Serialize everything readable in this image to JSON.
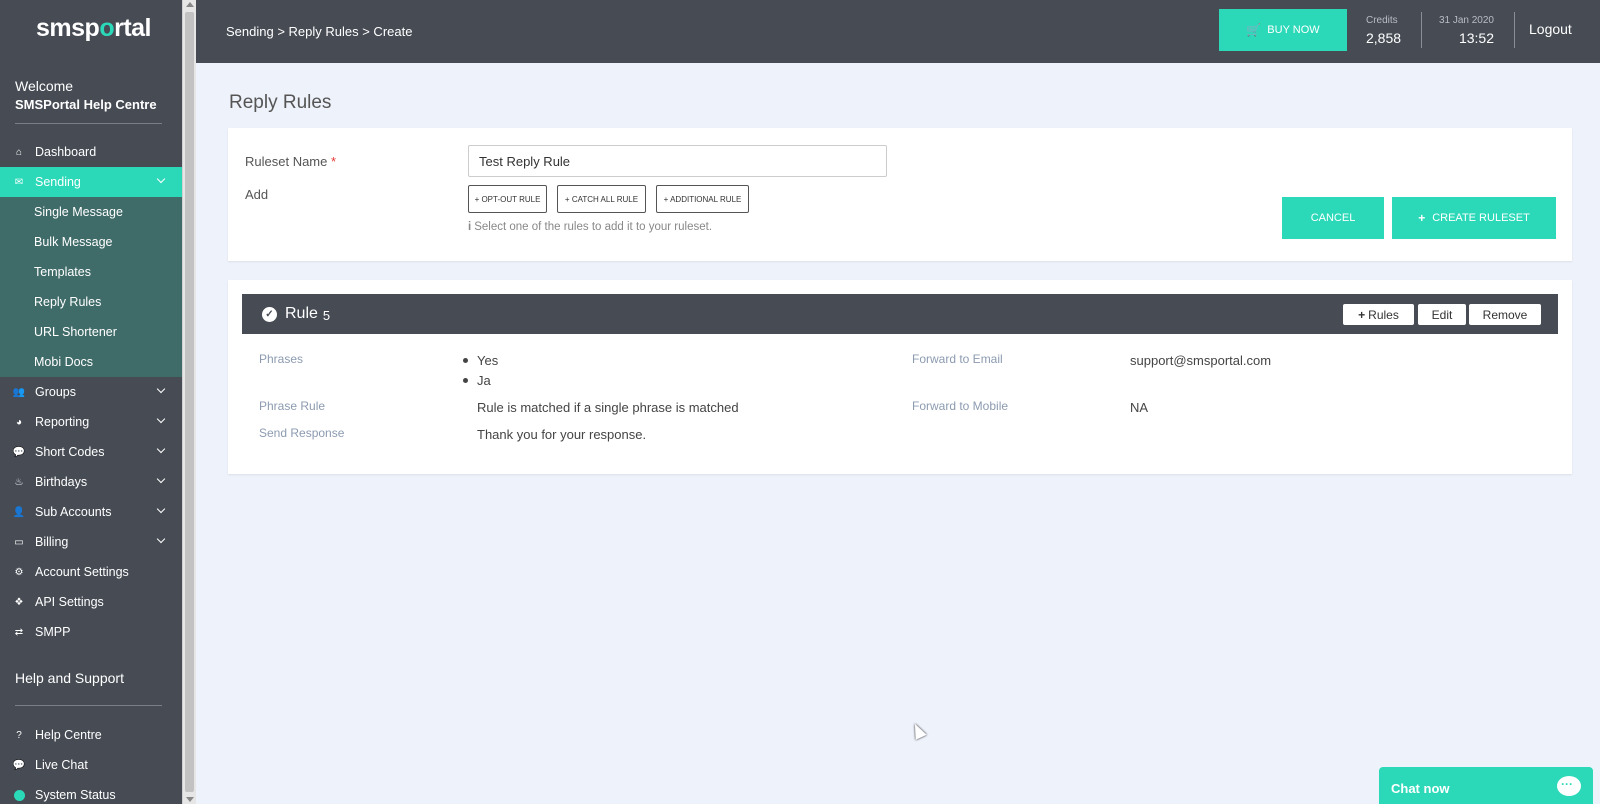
{
  "sidebar": {
    "logo_prefix": "smsp",
    "logo_o": "o",
    "logo_suffix": "rtal",
    "welcome": "Welcome",
    "account_name": "SMSPortal Help Centre",
    "nav": {
      "dashboard": "Dashboard",
      "sending": "Sending",
      "sub": {
        "single": "Single Message",
        "bulk": "Bulk Message",
        "templates": "Templates",
        "reply_rules": "Reply Rules",
        "url_shortener": "URL Shortener",
        "mobi_docs": "Mobi Docs"
      },
      "groups": "Groups",
      "reporting": "Reporting",
      "short_codes": "Short Codes",
      "birthdays": "Birthdays",
      "sub_accounts": "Sub Accounts",
      "billing": "Billing",
      "account_settings": "Account Settings",
      "api_settings": "API Settings",
      "smpp": "SMPP"
    },
    "help_heading": "Help and Support",
    "help": {
      "help_centre": "Help Centre",
      "live_chat": "Live Chat",
      "system_status": "System Status"
    },
    "accent_color": "#2bd9b9",
    "status_color": "#2bd9b9"
  },
  "topbar": {
    "breadcrumb": "Sending > Reply Rules > Create",
    "buy_now": "BUY NOW",
    "credits_label": "Credits",
    "credits_value": "2,858",
    "date": "31 Jan 2020",
    "time": "13:52",
    "logout": "Logout"
  },
  "page": {
    "title": "Reply Rules",
    "form": {
      "ruleset_label": "Ruleset Name",
      "required_mark": "*",
      "ruleset_value": "Test Reply Rule",
      "add_label": "Add",
      "btn_opt_out": "+ OPT-OUT RULE",
      "btn_catch_all": "+ CATCH ALL RULE",
      "btn_additional": "+ ADDITIONAL RULE",
      "hint_icon": "i",
      "hint": "Select one of the rules to add it to your ruleset.",
      "cancel": "CANCEL",
      "create_plus": "+",
      "create": "CREATE RULESET"
    },
    "rule": {
      "title": "Rule",
      "number": "5",
      "btn_rules_plus": "+",
      "btn_rules": "Rules",
      "btn_edit": "Edit",
      "btn_remove": "Remove",
      "phrases_label": "Phrases",
      "phrases": [
        "Yes",
        "Ja"
      ],
      "phrase_rule_label": "Phrase Rule",
      "phrase_rule": "Rule is matched if a single phrase is matched",
      "send_response_label": "Send Response",
      "send_response": "Thank you for your response.",
      "forward_email_label": "Forward to Email",
      "forward_email": "support@smsportal.com",
      "forward_mobile_label": "Forward to Mobile",
      "forward_mobile": "NA"
    }
  },
  "chat": {
    "label": "Chat now"
  }
}
